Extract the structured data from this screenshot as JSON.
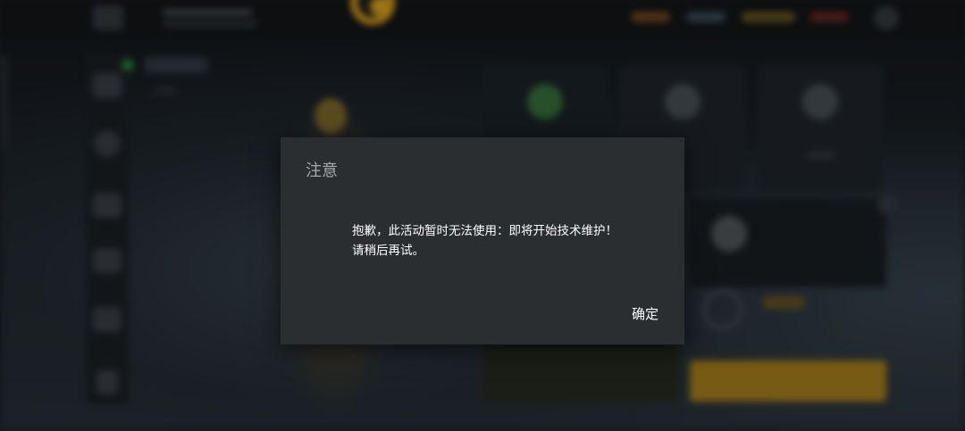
{
  "dialog": {
    "title": "注意",
    "message_line1": "抱歉，此活动暂时无法使用：即将开始技术维护！",
    "message_line2": "请稍后再试。",
    "confirm_label": "确定"
  },
  "colors": {
    "dialog_background": "#2b2e31",
    "dialog_title": "#a7aaac",
    "dialog_text": "#ffffff",
    "accent_gold": "#f0b020"
  }
}
